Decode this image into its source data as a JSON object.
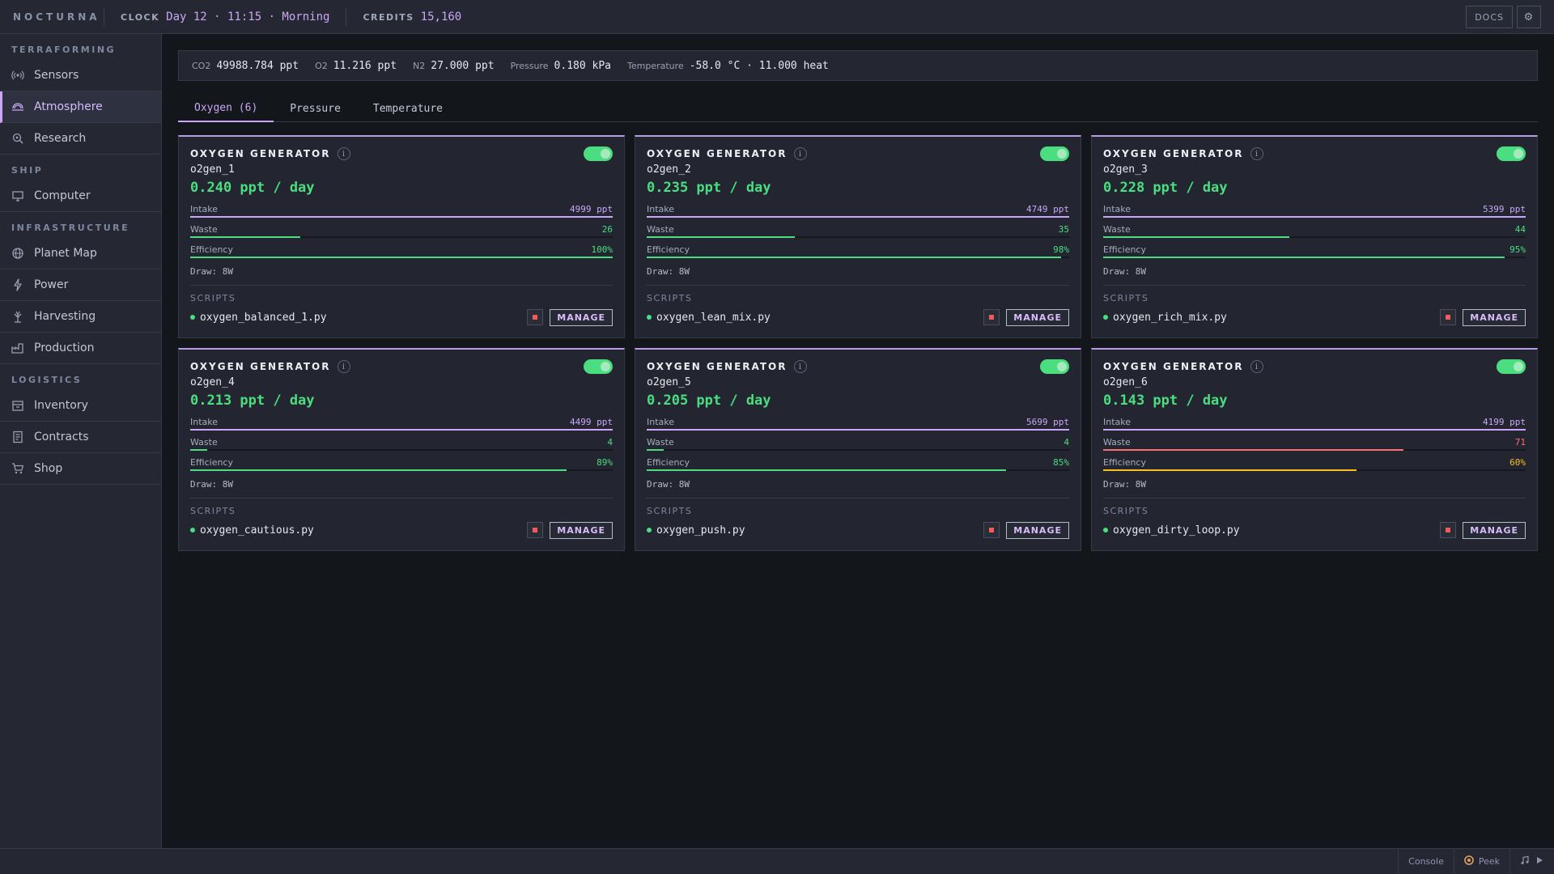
{
  "app": {
    "brand": "NOCTURNA",
    "clock_label": "CLOCK",
    "clock_value": "Day 12 · 11:15 · Morning",
    "credits_label": "CREDITS",
    "credits_value": "15,160",
    "docs_label": "DOCS",
    "settings_glyph": "⚙"
  },
  "sidebar": {
    "sections": [
      {
        "title": "TERRAFORMING",
        "items": [
          {
            "label": "Sensors",
            "icon": "sensor-icon"
          },
          {
            "label": "Atmosphere",
            "icon": "atmosphere-icon",
            "active": true
          },
          {
            "label": "Research",
            "icon": "research-icon"
          }
        ]
      },
      {
        "title": "SHIP",
        "items": [
          {
            "label": "Computer",
            "icon": "computer-icon"
          }
        ]
      },
      {
        "title": "INFRASTRUCTURE",
        "items": [
          {
            "label": "Planet Map",
            "icon": "globe-icon"
          },
          {
            "label": "Power",
            "icon": "bolt-icon"
          },
          {
            "label": "Harvesting",
            "icon": "harvest-icon"
          },
          {
            "label": "Production",
            "icon": "factory-icon"
          }
        ]
      },
      {
        "title": "LOGISTICS",
        "items": [
          {
            "label": "Inventory",
            "icon": "box-icon"
          },
          {
            "label": "Contracts",
            "icon": "document-icon"
          },
          {
            "label": "Shop",
            "icon": "cart-icon"
          }
        ]
      }
    ]
  },
  "environment": [
    {
      "key": "CO2",
      "value": "49988.784 ppt"
    },
    {
      "key": "O2",
      "value": "11.216 ppt"
    },
    {
      "key": "N2",
      "value": "27.000 ppt"
    },
    {
      "key": "Pressure",
      "value": "0.180 kPa"
    },
    {
      "key": "Temperature",
      "value": "-58.0 °C · 11.000 heat"
    }
  ],
  "tabs": [
    {
      "label": "Oxygen (6)",
      "active": true
    },
    {
      "label": "Pressure"
    },
    {
      "label": "Temperature"
    }
  ],
  "labels": {
    "card_type": "OXYGEN GENERATOR",
    "info_glyph": "i",
    "intake": "Intake",
    "waste": "Waste",
    "efficiency": "Efficiency",
    "scripts": "SCRIPTS",
    "manage": "MANAGE"
  },
  "colors": {
    "accent": "#cba6f7",
    "green": "#4ade80",
    "red": "#f87171",
    "amber": "#fbbf24"
  },
  "generators": [
    {
      "id": "o2gen_1",
      "rate": "0.240 ppt / day",
      "enabled": true,
      "intake": "4999 ppt",
      "intake_level": 1.0,
      "waste": "26",
      "waste_level": 0.26,
      "waste_status": "green",
      "efficiency": "100%",
      "efficiency_level": 1.0,
      "efficiency_status": "green",
      "draw": "Draw: 8W",
      "script": "oxygen_balanced_1.py"
    },
    {
      "id": "o2gen_2",
      "rate": "0.235 ppt / day",
      "enabled": true,
      "intake": "4749 ppt",
      "intake_level": 1.0,
      "waste": "35",
      "waste_level": 0.35,
      "waste_status": "green",
      "efficiency": "98%",
      "efficiency_level": 0.98,
      "efficiency_status": "green",
      "draw": "Draw: 8W",
      "script": "oxygen_lean_mix.py"
    },
    {
      "id": "o2gen_3",
      "rate": "0.228 ppt / day",
      "enabled": true,
      "intake": "5399 ppt",
      "intake_level": 1.0,
      "waste": "44",
      "waste_level": 0.44,
      "waste_status": "green",
      "efficiency": "95%",
      "efficiency_level": 0.95,
      "efficiency_status": "green",
      "draw": "Draw: 8W",
      "script": "oxygen_rich_mix.py"
    },
    {
      "id": "o2gen_4",
      "rate": "0.213 ppt / day",
      "enabled": true,
      "intake": "4499 ppt",
      "intake_level": 1.0,
      "waste": "4",
      "waste_level": 0.04,
      "waste_status": "green",
      "efficiency": "89%",
      "efficiency_level": 0.89,
      "efficiency_status": "green",
      "draw": "Draw: 8W",
      "script": "oxygen_cautious.py"
    },
    {
      "id": "o2gen_5",
      "rate": "0.205 ppt / day",
      "enabled": true,
      "intake": "5699 ppt",
      "intake_level": 1.0,
      "waste": "4",
      "waste_level": 0.04,
      "waste_status": "green",
      "efficiency": "85%",
      "efficiency_level": 0.85,
      "efficiency_status": "green",
      "draw": "Draw: 8W",
      "script": "oxygen_push.py"
    },
    {
      "id": "o2gen_6",
      "rate": "0.143 ppt / day",
      "enabled": true,
      "intake": "4199 ppt",
      "intake_level": 1.0,
      "waste": "71",
      "waste_level": 0.71,
      "waste_status": "red",
      "efficiency": "60%",
      "efficiency_level": 0.6,
      "efficiency_status": "amber",
      "draw": "Draw: 8W",
      "script": "oxygen_dirty_loop.py"
    }
  ],
  "footer": {
    "console_label": "Console",
    "peek_label": "Peek"
  }
}
